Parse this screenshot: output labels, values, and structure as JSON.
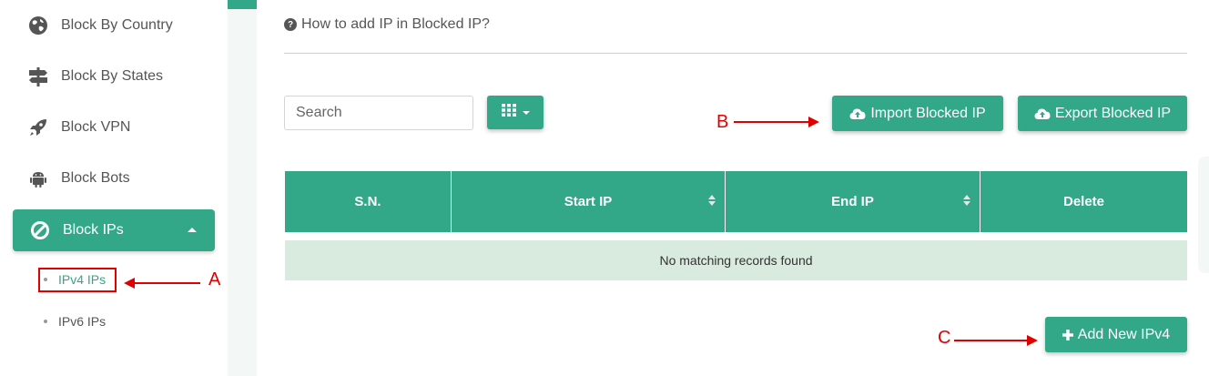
{
  "sidebar": {
    "items": [
      {
        "label": "Block By Country",
        "icon": "globe-icon"
      },
      {
        "label": "Block By States",
        "icon": "signpost-icon"
      },
      {
        "label": "Block VPN",
        "icon": "rocket-icon"
      },
      {
        "label": "Block Bots",
        "icon": "android-icon"
      },
      {
        "label": "Block IPs",
        "icon": "ban-icon",
        "active": true
      }
    ],
    "subitems": [
      {
        "label": "IPv4 IPs",
        "active": true
      },
      {
        "label": "IPv6 IPs"
      }
    ]
  },
  "help": {
    "text": "How to add IP in Blocked IP?"
  },
  "toolbar": {
    "search_placeholder": "Search",
    "import_label": "Import Blocked IP",
    "export_label": "Export Blocked IP"
  },
  "table": {
    "columns": [
      "S.N.",
      "Start IP",
      "End IP",
      "Delete"
    ],
    "empty_message": "No matching records found"
  },
  "footer": {
    "add_label": "Add New IPv4"
  },
  "annotations": {
    "a": "A",
    "b": "B",
    "c": "C"
  },
  "colors": {
    "accent": "#32a889",
    "annotation": "#e00000",
    "empty_row": "#d9eade"
  }
}
